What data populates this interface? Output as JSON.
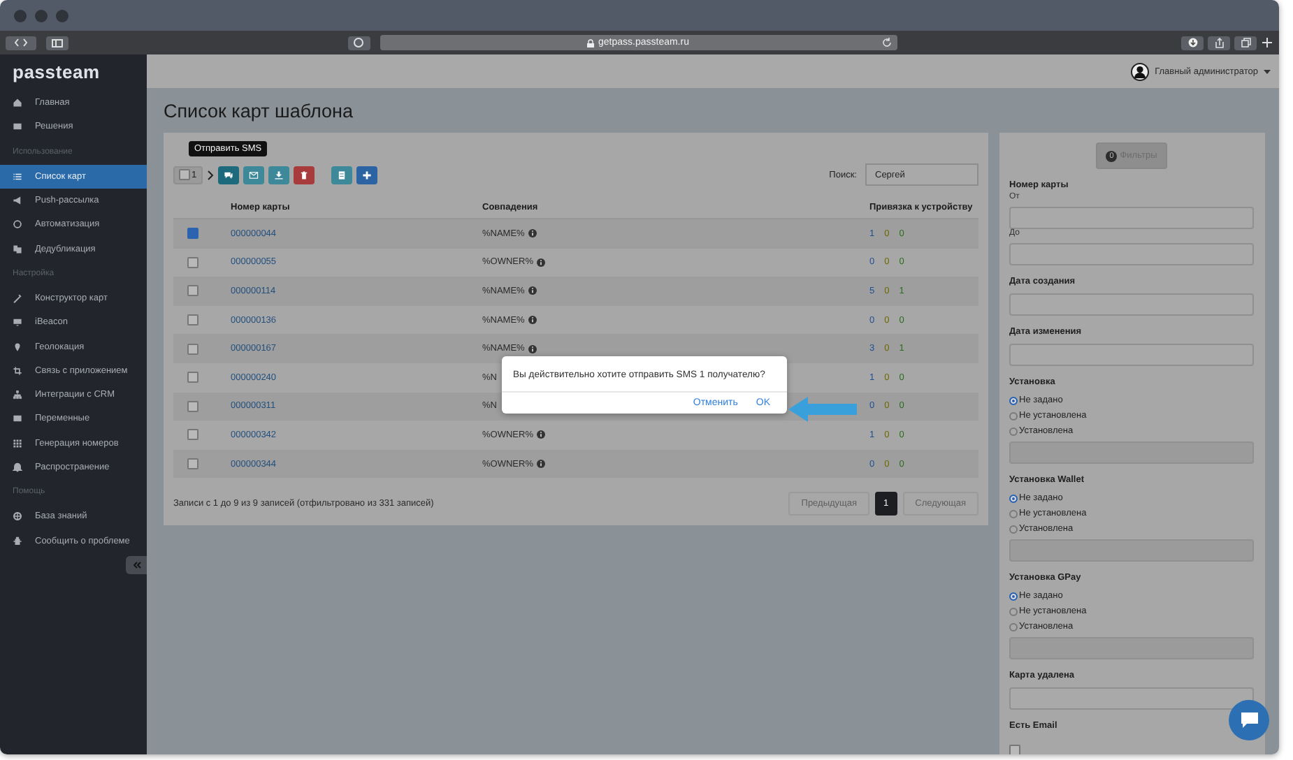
{
  "browser": {
    "url": "getpass.passteam.ru"
  },
  "sidebar": {
    "logo": "passteam",
    "items": [
      {
        "kind": "item",
        "label": "Главная",
        "selected": false
      },
      {
        "kind": "item",
        "label": "Решения",
        "selected": false
      },
      {
        "kind": "header",
        "label": "Использование"
      },
      {
        "kind": "item",
        "label": "Список карт",
        "selected": true
      },
      {
        "kind": "item",
        "label": "Push-рассылка",
        "selected": false
      },
      {
        "kind": "item",
        "label": "Автоматизация",
        "selected": false
      },
      {
        "kind": "item",
        "label": "Дедубликация",
        "selected": false
      },
      {
        "kind": "header",
        "label": "Настройка"
      },
      {
        "kind": "item",
        "label": "Конструктор карт",
        "selected": false
      },
      {
        "kind": "item",
        "label": "iBeacon",
        "selected": false
      },
      {
        "kind": "item",
        "label": "Геолокация",
        "selected": false
      },
      {
        "kind": "item",
        "label": "Связь с приложением",
        "selected": false
      },
      {
        "kind": "item",
        "label": "Интеграции с CRM",
        "selected": false
      },
      {
        "kind": "item",
        "label": "Переменные",
        "selected": false
      },
      {
        "kind": "item",
        "label": "Генерация номеров",
        "selected": false
      },
      {
        "kind": "item",
        "label": "Распространение",
        "selected": false
      },
      {
        "kind": "header",
        "label": "Помощь"
      },
      {
        "kind": "item",
        "label": "База знаний",
        "selected": false
      },
      {
        "kind": "item",
        "label": "Сообщить о проблеме",
        "selected": false
      }
    ]
  },
  "header": {
    "user": "Главный администратор"
  },
  "page_title": "Список карт шаблона",
  "toolbar": {
    "select": {
      "checked": false,
      "count": "1"
    },
    "tooltip": "Отправить SMS",
    "button_groups": [
      [
        {
          "kind": "sms",
          "color": "#1d6a7c"
        },
        {
          "kind": "email",
          "color": "#3e8999"
        },
        {
          "kind": "download",
          "color": "#3e8999"
        },
        {
          "kind": "delete",
          "color": "#a83c3c"
        }
      ],
      [
        {
          "kind": "archive",
          "color": "#3e8999"
        },
        {
          "kind": "add",
          "color": "#2c63a3"
        }
      ]
    ],
    "search": {
      "label": "Поиск:",
      "value": "Сергей"
    }
  },
  "table": {
    "columns": [
      "Номер карты",
      "Совпадения",
      "Привязка к устройству"
    ],
    "rows": [
      {
        "selected": true,
        "number": "000000044",
        "match": "%NAME%",
        "info": true,
        "counts": [
          "1",
          "0",
          "0"
        ]
      },
      {
        "selected": false,
        "number": "000000055",
        "match": "%OWNER%",
        "info": true,
        "counts": [
          "0",
          "0",
          "0"
        ]
      },
      {
        "selected": false,
        "number": "000000114",
        "match": "%NAME%",
        "info": true,
        "counts": [
          "5",
          "0",
          "1"
        ]
      },
      {
        "selected": false,
        "number": "000000136",
        "match": "%NAME%",
        "info": true,
        "counts": [
          "0",
          "0",
          "0"
        ]
      },
      {
        "selected": false,
        "number": "000000167",
        "match": "%NAME%",
        "info": true,
        "counts": [
          "3",
          "0",
          "1"
        ]
      },
      {
        "selected": false,
        "number": "000000240",
        "match": "%N",
        "info": false,
        "counts": [
          "1",
          "0",
          "0"
        ]
      },
      {
        "selected": false,
        "number": "000000311",
        "match": "%N",
        "info": false,
        "counts": [
          "0",
          "0",
          "0"
        ]
      },
      {
        "selected": false,
        "number": "000000342",
        "match": "%OWNER%",
        "info": true,
        "counts": [
          "1",
          "0",
          "0"
        ]
      },
      {
        "selected": false,
        "number": "000000344",
        "match": "%OWNER%",
        "info": true,
        "counts": [
          "0",
          "0",
          "0"
        ]
      }
    ],
    "summary": "Записи с 1 до 9 из 9 записей (отфильтровано из 331 записей)",
    "pagination": [
      {
        "label": "Предыдущая",
        "kind": "nav",
        "disabled": true
      },
      {
        "label": "1",
        "kind": "page",
        "selected": true
      },
      {
        "label": "Следующая",
        "kind": "nav",
        "disabled": true
      }
    ]
  },
  "filters": {
    "button": {
      "badge": "0",
      "label": "Фильтры"
    },
    "groups": [
      {
        "kind": "range",
        "label": "Номер карты",
        "fields": [
          "От",
          "До"
        ]
      },
      {
        "kind": "input",
        "label": "Дата создания"
      },
      {
        "kind": "input",
        "label": "Дата изменения"
      },
      {
        "kind": "radio",
        "label": "Установка",
        "options": [
          {
            "label": "Не задано",
            "selected": true
          },
          {
            "label": "Не установлена",
            "selected": false
          },
          {
            "label": "Установлена",
            "selected": false
          }
        ]
      },
      {
        "kind": "radio",
        "label": "Установка Wallet",
        "options": [
          {
            "label": "Не задано",
            "selected": true
          },
          {
            "label": "Не установлена",
            "selected": false
          },
          {
            "label": "Установлена",
            "selected": false
          }
        ]
      },
      {
        "kind": "radio",
        "label": "Установка GPay",
        "options": [
          {
            "label": "Не задано",
            "selected": true
          },
          {
            "label": "Не установлена",
            "selected": false
          },
          {
            "label": "Установлена",
            "selected": false
          }
        ]
      },
      {
        "kind": "input",
        "label": "Карта удалена"
      },
      {
        "kind": "checkbox",
        "label": "Есть Email",
        "checked": false
      }
    ]
  },
  "dialog": {
    "message": "Вы действительно хотите отправить SMS 1 получателю?",
    "buttons": [
      {
        "label": "Отменить"
      },
      {
        "label": "OK"
      }
    ]
  }
}
